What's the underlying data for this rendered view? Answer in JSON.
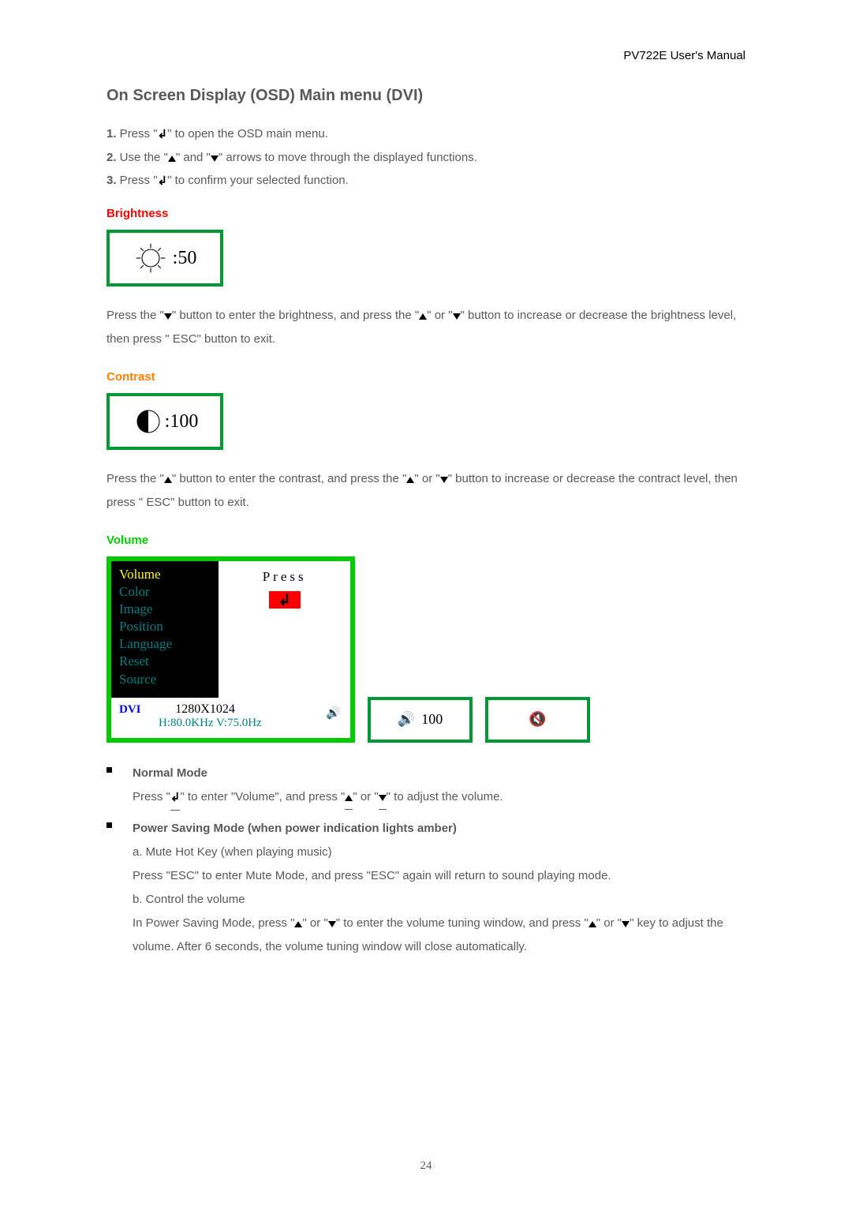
{
  "header": {
    "doc_title": "PV722E User's Manual"
  },
  "title": "On Screen Display (OSD) Main menu (DVI)",
  "steps": {
    "s1": {
      "num": "1.",
      "before": " Press \"",
      "after": "\" to open the OSD main menu."
    },
    "s2": {
      "num": "2.",
      "before": " Use the \"",
      "mid": "\" and \"",
      "after": "\" arrows to move through the displayed functions."
    },
    "s3": {
      "num": "3.",
      "before": " Press \"",
      "after": "\" to confirm your selected function."
    }
  },
  "brightness": {
    "heading": "Brightness",
    "value": ":50",
    "desc_a": "Press the \"",
    "desc_b": "\" button to enter the brightness, and press the \"",
    "desc_c": "\" or \"",
    "desc_d": "\" button to increase or decrease the brightness level, then press \" ESC\" button to exit."
  },
  "contrast": {
    "heading": "Contrast",
    "value": ":100",
    "desc_a": "Press the \"",
    "desc_b": "\" button to enter the contrast, and press the \"",
    "desc_c": "\" or \"",
    "desc_d": "\" button to increase or decrease the contract level, then press \" ESC\" button to exit."
  },
  "volume": {
    "heading": "Volume",
    "menu_items": {
      "i0": "Volume",
      "i1": "Color",
      "i2": "Image",
      "i3": "Position",
      "i4": "Language",
      "i5": "Reset",
      "i6": "Source"
    },
    "press_label": "Press",
    "status": {
      "signal": "DVI",
      "resolution": "1280X1024",
      "freq": "H:80.0KHz  V:75.0Hz"
    },
    "vol_value": "100"
  },
  "modes": {
    "normal": {
      "title": "Normal Mode",
      "line_a": "Press \"",
      "line_b": "\" to enter \"Volume\", and press \"",
      "line_c": "\" or \"",
      "line_d": "\" to adjust the volume."
    },
    "powersave": {
      "title": "Power Saving Mode (when power indication lights amber)",
      "a_label": "a. Mute Hot Key (when playing music)",
      "a_line": "Press \"ESC\" to enter Mute Mode, and press \"ESC\" again will return to sound playing mode.",
      "b_label": "b. Control the volume",
      "b_line_a": "In Power Saving Mode, press \"",
      "b_line_b": "\" or \"",
      "b_line_c": "\" to enter the volume tuning window, and press \"",
      "b_line_d": "\" or \"",
      "b_line_e": "\" key to adjust the volume. After 6 seconds, the volume tuning window will close automatically."
    }
  },
  "page_number": "24"
}
